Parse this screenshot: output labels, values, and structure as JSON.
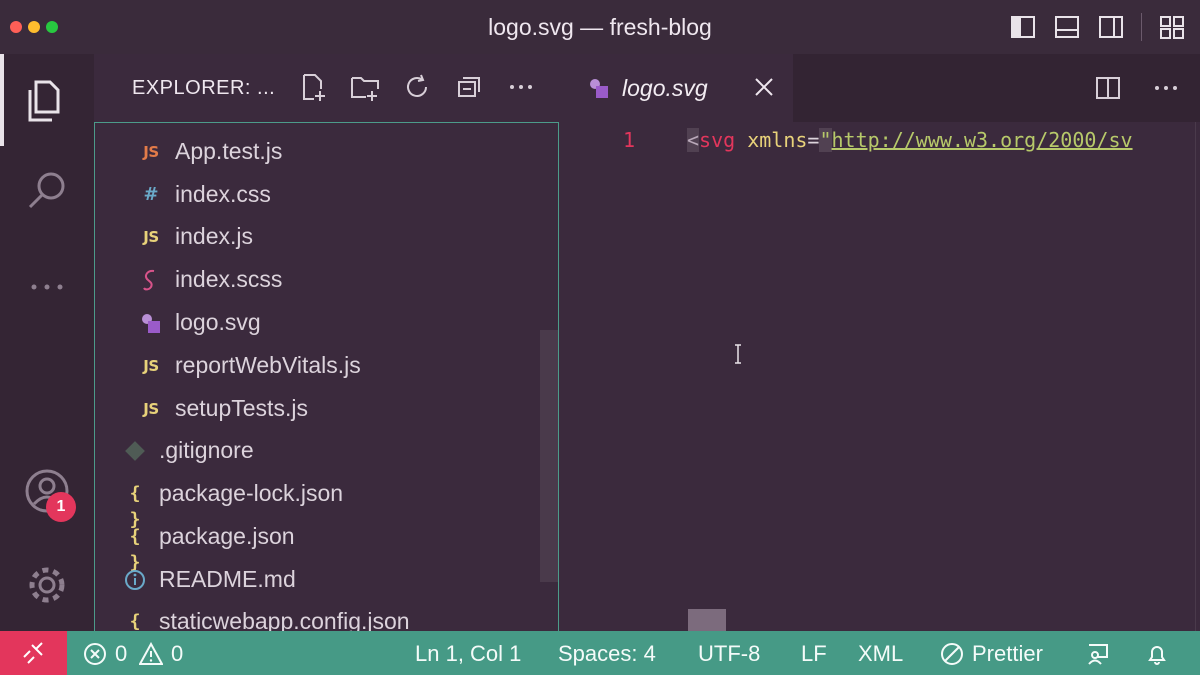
{
  "window": {
    "title": "logo.svg — fresh-blog"
  },
  "sidebar": {
    "title": "EXPLORER: ...",
    "files": [
      {
        "name": "App.test.js",
        "icon": "js-test-icon",
        "icon_text": "JS"
      },
      {
        "name": "index.css",
        "icon": "css-hash-icon",
        "icon_text": "#"
      },
      {
        "name": "index.js",
        "icon": "js-icon",
        "icon_text": "JS"
      },
      {
        "name": "index.scss",
        "icon": "sass-icon",
        "icon_text": ""
      },
      {
        "name": "logo.svg",
        "icon": "svg-icon",
        "icon_text": ""
      },
      {
        "name": "reportWebVitals.js",
        "icon": "js-icon",
        "icon_text": "JS"
      },
      {
        "name": "setupTests.js",
        "icon": "js-icon",
        "icon_text": "JS"
      },
      {
        "name": ".gitignore",
        "icon": "git-icon",
        "icon_text": ""
      },
      {
        "name": "package-lock.json",
        "icon": "json-icon",
        "icon_text": "{ }"
      },
      {
        "name": "package.json",
        "icon": "json-icon",
        "icon_text": "{ }"
      },
      {
        "name": "README.md",
        "icon": "info-icon",
        "icon_text": ""
      },
      {
        "name": "staticwebapp.config.json",
        "icon": "json-icon",
        "icon_text": "{ }"
      }
    ]
  },
  "activity": {
    "badge": "1"
  },
  "editor": {
    "tab_label": "logo.svg",
    "line_number": "1",
    "code": {
      "open": "<",
      "tag": "svg",
      "attr": " xmlns",
      "eq": "=",
      "quote": "\"",
      "url": "http://www.w3.org/2000/sv"
    }
  },
  "status": {
    "errors": "0",
    "warnings": "0",
    "position": "Ln 1, Col 1",
    "spaces": "Spaces: 4",
    "encoding": "UTF-8",
    "eol": "LF",
    "language": "XML",
    "formatter": "Prettier"
  },
  "colors": {
    "accent_red": "#e3365c",
    "status_bg": "#469a86",
    "editor_bg": "#3b2a3d"
  }
}
